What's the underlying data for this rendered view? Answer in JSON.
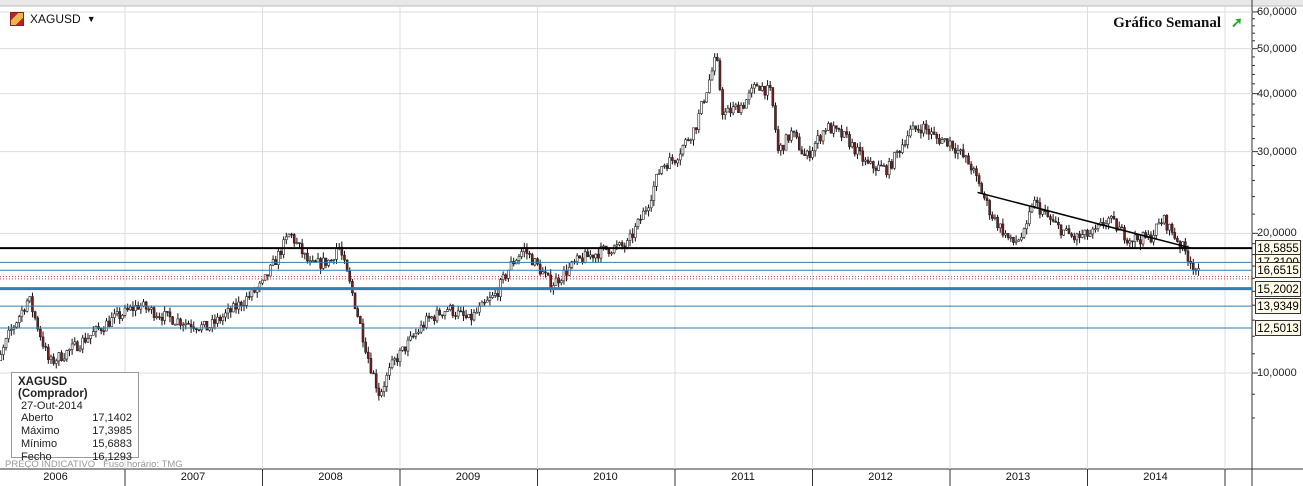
{
  "header": {
    "symbol": "XAGUSD",
    "title": "Gráfico Semanal",
    "trend_icon": "trend-up-icon"
  },
  "info": {
    "title": "XAGUSD (Comprador)",
    "date": "27-Out-2014",
    "rows": [
      {
        "label": "Aberto",
        "value": "17,1402"
      },
      {
        "label": "Máximo",
        "value": "17,3985"
      },
      {
        "label": "Mínimo",
        "value": "15,6883"
      },
      {
        "label": "Fecho",
        "value": "16,1293"
      }
    ]
  },
  "footer": {
    "price_note": "PREÇO INDICATIVO",
    "timezone": "Fuso horário: TMG"
  },
  "colors": {
    "up": "#ffffff",
    "down": "#7a1c1c",
    "support": "#2e7fb5",
    "resistance": "#000000"
  },
  "chart_data": {
    "type": "candlestick",
    "scale": "log",
    "ylim": [
      7,
      62
    ],
    "y_ticks": [
      {
        "v": 60,
        "label": "60,0000"
      },
      {
        "v": 50,
        "label": "50,0000"
      },
      {
        "v": 40,
        "label": "40,0000"
      },
      {
        "v": 30,
        "label": "30,0000"
      },
      {
        "v": 20,
        "label": "20,0000"
      },
      {
        "v": 10,
        "label": "10,0000"
      }
    ],
    "x_ticks": [
      "2006",
      "2007",
      "2008",
      "2009",
      "2010",
      "2011",
      "2012",
      "2013",
      "2014"
    ],
    "levels": [
      {
        "v": 18.5855,
        "label": "18,5855",
        "style": "black"
      },
      {
        "v": 17.31,
        "label": "17,3100",
        "style": "thin"
      },
      {
        "v": 16.6515,
        "label": "16,6515",
        "style": "thin"
      },
      {
        "v": 15.2002,
        "label": "15,2002",
        "style": "thick"
      },
      {
        "v": 13.9349,
        "label": "13,9349",
        "style": "thin"
      },
      {
        "v": 12.5013,
        "label": "12,5013",
        "style": "thin"
      }
    ],
    "price_path": [
      [
        2006.0,
        9.0
      ],
      [
        2006.15,
        12
      ],
      [
        2006.3,
        14.5
      ],
      [
        2006.45,
        10.5
      ],
      [
        2006.6,
        11.2
      ],
      [
        2006.9,
        13
      ],
      [
        2007.1,
        14
      ],
      [
        2007.3,
        13.2
      ],
      [
        2007.6,
        12.5
      ],
      [
        2007.8,
        13.8
      ],
      [
        2008.0,
        15.5
      ],
      [
        2008.2,
        20
      ],
      [
        2008.35,
        17
      ],
      [
        2008.5,
        17.5
      ],
      [
        2008.55,
        19
      ],
      [
        2008.65,
        15
      ],
      [
        2008.78,
        10.5
      ],
      [
        2008.85,
        9.0
      ],
      [
        2008.95,
        10.5
      ],
      [
        2009.1,
        12
      ],
      [
        2009.2,
        13
      ],
      [
        2009.35,
        13.8
      ],
      [
        2009.5,
        13
      ],
      [
        2009.7,
        14.8
      ],
      [
        2009.8,
        17
      ],
      [
        2009.9,
        18.5
      ],
      [
        2010.0,
        17
      ],
      [
        2010.1,
        15.5
      ],
      [
        2010.3,
        17.5
      ],
      [
        2010.5,
        18.5
      ],
      [
        2010.65,
        18.8
      ],
      [
        2010.8,
        23
      ],
      [
        2010.9,
        28
      ],
      [
        2011.0,
        29
      ],
      [
        2011.15,
        34
      ],
      [
        2011.3,
        48
      ],
      [
        2011.35,
        36
      ],
      [
        2011.5,
        38
      ],
      [
        2011.6,
        42
      ],
      [
        2011.7,
        40
      ],
      [
        2011.75,
        30
      ],
      [
        2011.85,
        33
      ],
      [
        2011.95,
        29
      ],
      [
        2012.1,
        34
      ],
      [
        2012.25,
        32
      ],
      [
        2012.4,
        28
      ],
      [
        2012.55,
        27.5
      ],
      [
        2012.7,
        33
      ],
      [
        2012.8,
        34
      ],
      [
        2012.9,
        32
      ],
      [
        2013.0,
        31.5
      ],
      [
        2013.15,
        28
      ],
      [
        2013.3,
        22
      ],
      [
        2013.45,
        19
      ],
      [
        2013.55,
        20
      ],
      [
        2013.6,
        23.5
      ],
      [
        2013.75,
        21
      ],
      [
        2013.9,
        19.5
      ],
      [
        2014.05,
        20
      ],
      [
        2014.15,
        21.5
      ],
      [
        2014.3,
        19.5
      ],
      [
        2014.45,
        19.5
      ],
      [
        2014.55,
        21.5
      ],
      [
        2014.7,
        18.5
      ],
      [
        2014.82,
        16.13
      ]
    ],
    "trendline": [
      [
        2013.2,
        24.5
      ],
      [
        2014.75,
        18.6
      ]
    ]
  }
}
